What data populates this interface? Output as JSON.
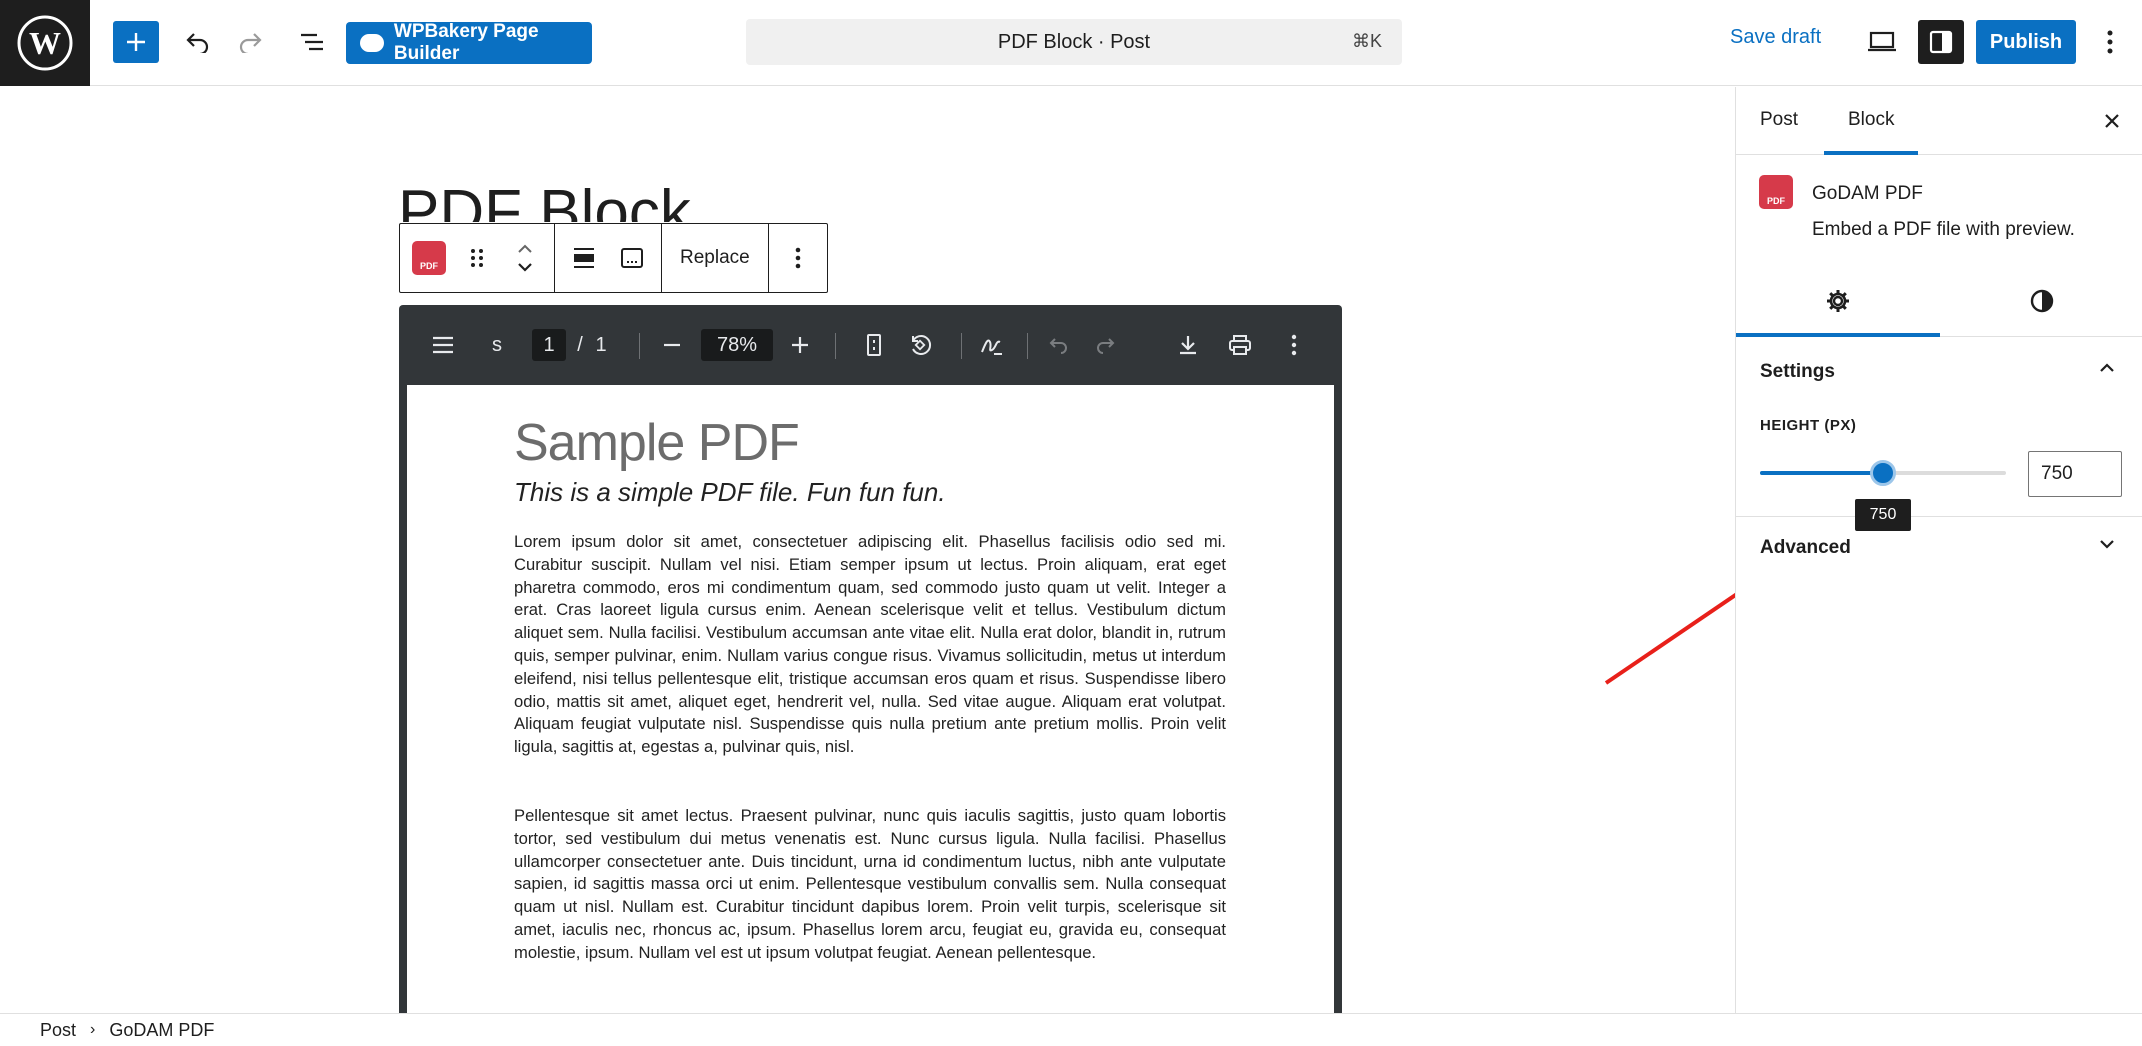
{
  "topbar": {
    "wpb_label": "WPBakery Page Builder",
    "command_title": "PDF Block · Post",
    "command_shortcut": "⌘K",
    "save_draft": "Save draft",
    "publish": "Publish"
  },
  "editor": {
    "post_title": "PDF Block",
    "block_toolbar": {
      "replace": "Replace"
    },
    "pdf_toolbar": {
      "doc_title": "s",
      "current_page": "1",
      "page_sep": "/",
      "total_pages": "1",
      "zoom": "78%"
    },
    "pdf_page": {
      "heading": "Sample PDF",
      "subheading": "This is a simple PDF file. Fun fun fun.",
      "paragraph1": "Lorem ipsum dolor sit amet, consectetuer adipiscing elit. Phasellus facilisis odio sed mi. Curabitur suscipit. Nullam vel nisi. Etiam semper ipsum ut lectus. Proin aliquam, erat eget pharetra commodo, eros mi condimentum quam, sed commodo justo quam ut velit. Integer a erat. Cras laoreet ligula cursus enim. Aenean scelerisque velit et tellus. Vestibulum dictum aliquet sem. Nulla facilisi. Vestibulum accumsan ante vitae elit. Nulla erat dolor, blandit in, rutrum quis, semper pulvinar, enim. Nullam varius congue risus. Vivamus sollicitudin, metus ut interdum eleifend, nisi tellus pellentesque elit, tristique accumsan eros quam et risus. Suspendisse libero odio, mattis sit amet, aliquet eget, hendrerit vel, nulla. Sed vitae augue. Aliquam erat volutpat. Aliquam feugiat vulputate nisl. Suspendisse quis nulla pretium ante pretium mollis. Proin velit ligula, sagittis at, egestas a, pulvinar quis, nisl.",
      "paragraph2": "Pellentesque sit amet lectus. Praesent pulvinar, nunc quis iaculis sagittis, justo quam lobortis tortor, sed vestibulum dui metus venenatis est. Nunc cursus ligula. Nulla facilisi. Phasellus ullamcorper consectetuer ante. Duis tincidunt, urna id condimentum luctus, nibh ante vulputate sapien, id sagittis massa orci ut enim. Pellentesque vestibulum convallis sem. Nulla consequat quam ut nisl. Nullam est. Curabitur tincidunt dapibus lorem. Proin velit turpis, scelerisque sit amet, iaculis nec, rhoncus ac, ipsum. Phasellus lorem arcu, feugiat eu, gravida eu, consequat molestie, ipsum. Nullam vel est ut ipsum volutpat feugiat. Aenean pellentesque."
    }
  },
  "sidebar": {
    "tabs": [
      {
        "label": "Post"
      },
      {
        "label": "Block"
      }
    ],
    "active_tab": "Block",
    "block": {
      "name": "GoDAM PDF",
      "description": "Embed a PDF file with preview."
    },
    "settings_panel": {
      "title": "Settings",
      "height_label": "HEIGHT (PX)",
      "height_value": "750",
      "slider_fraction": 0.5,
      "tooltip": "750"
    },
    "advanced_panel": {
      "title": "Advanced"
    }
  },
  "footer": {
    "breadcrumb": [
      {
        "label": "Post"
      },
      {
        "label": "GoDAM PDF"
      }
    ]
  },
  "colors": {
    "accent": "#0a70c2",
    "pdf_icon": "#d63a4a",
    "viewer_bar": "#323639",
    "annotation_arrow": "#e8201a"
  },
  "icons": {
    "logo": "wordpress-logo-icon",
    "add": "plus-icon",
    "undo": "undo-icon",
    "redo": "redo-icon",
    "list_view": "list-view-icon",
    "view": "desktop-view-icon",
    "settings": "sidebar-toggle-icon",
    "more": "kebab-menu-icon"
  }
}
